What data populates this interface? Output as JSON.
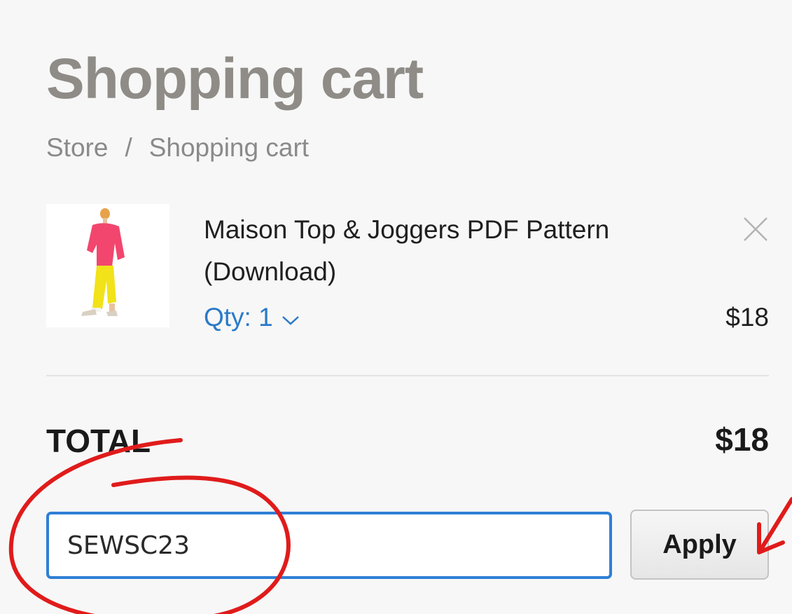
{
  "page": {
    "title": "Shopping cart",
    "breadcrumb": {
      "store": "Store",
      "separator": "/",
      "current": "Shopping cart"
    }
  },
  "cart": {
    "items": [
      {
        "name": "Maison Top & Joggers PDF Pattern (Download)",
        "qty_label": "Qty: 1",
        "price": "$18",
        "thumbnail_icon": "pattern-illustration"
      }
    ],
    "total_label": "TOTAL",
    "total_value": "$18"
  },
  "promo": {
    "value": "SEWSC23",
    "apply_label": "Apply"
  },
  "colors": {
    "accent": "#2a7ac8",
    "annotation": "#e01b1b",
    "title": "#8f8c87"
  }
}
